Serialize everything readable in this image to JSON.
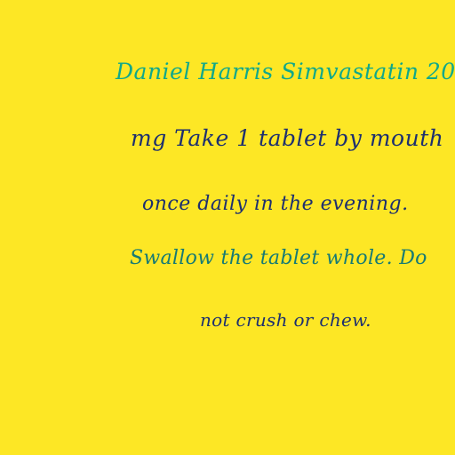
{
  "label": {
    "patient_and_drug": "Daniel Harris Simvastatin 20",
    "line2": "mg Take 1 tablet by mouth",
    "line3": "once daily in the evening.",
    "line4": "Swallow the tablet whole. Do",
    "line5": "not crush or chew."
  },
  "colors": {
    "background": "#fde725",
    "heading_text": "#10a88a",
    "body_text": "#1d2f6f",
    "accent_text": "#167a74"
  }
}
